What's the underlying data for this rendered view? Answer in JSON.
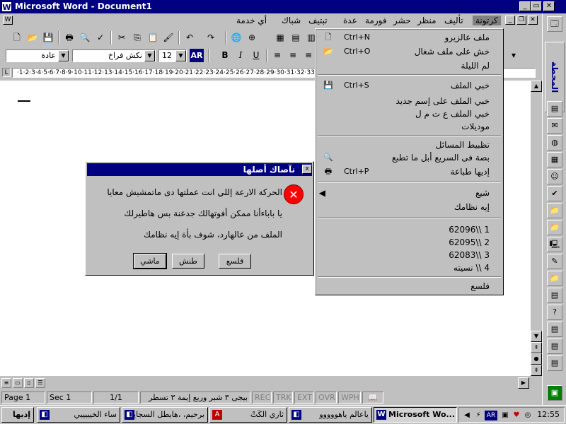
{
  "window": {
    "title": "Microsoft Word - Document1",
    "app_icon": "W"
  },
  "menubar": {
    "items": [
      "كرتونة",
      "تأليف",
      "منظر",
      "حشر",
      "فورمة",
      "عدة",
      "تبتيف",
      "شباك",
      "أي خدمة"
    ]
  },
  "toolbar": {
    "style_value": "عادة",
    "font_value": "نكش فراخ",
    "size_value": "12",
    "ar_label": "AR",
    "bold": "B",
    "italic": "I",
    "underline": "U"
  },
  "ruler": {
    "text": "·1·2·3·4·5·6·7·8·9·10·11·12·13·14·15·16·17·18·19·20·21·22·23·24·25·26·27·28·29·30·31·32·33·34·35·36·37·38·39·40·"
  },
  "file_menu": {
    "items": [
      {
        "label": "ملف عالزيرو",
        "shortcut": "Ctrl+N",
        "icon": "new-doc-icon"
      },
      {
        "label": "خش على ملف شغال",
        "shortcut": "Ctrl+O",
        "icon": "open-folder-icon"
      },
      {
        "label": "لم الليلة",
        "shortcut": "",
        "icon": ""
      },
      {
        "label": "خبي الملف",
        "shortcut": "Ctrl+S",
        "icon": "save-disk-icon"
      },
      {
        "label": "خبي الملف على إسم جديد",
        "shortcut": "",
        "icon": ""
      },
      {
        "label": "خبي الملف ع ت م ل",
        "shortcut": "",
        "icon": ""
      },
      {
        "label": "موديلات",
        "shortcut": "",
        "icon": ""
      },
      {
        "label": "تظبيط المسائل",
        "shortcut": "",
        "icon": ""
      },
      {
        "label": "بصة فى السريع أبل ما تطبع",
        "shortcut": "",
        "icon": "print-preview-icon"
      },
      {
        "label": "إديها طباعة",
        "shortcut": "Ctrl+P",
        "icon": "printer-icon"
      },
      {
        "label": "شيع",
        "shortcut": "",
        "icon": "",
        "submenu": true
      },
      {
        "label": "إيه نظامك",
        "shortcut": "",
        "icon": ""
      },
      {
        "label": "1 \\\\62096",
        "shortcut": "",
        "icon": ""
      },
      {
        "label": "2 \\\\62095",
        "shortcut": "",
        "icon": ""
      },
      {
        "label": "3 \\\\62083",
        "shortcut": "",
        "icon": ""
      },
      {
        "label": "4 \\\\ نسيته",
        "shortcut": "",
        "icon": ""
      },
      {
        "label": "فلسع",
        "shortcut": "",
        "icon": ""
      }
    ]
  },
  "dialog": {
    "title": "نآصاك أصلها",
    "close": "x",
    "lines": [
      "الحركة الارعة إللي انت عملتها دى ماتمشيش معايا",
      "يا باباءأنا ممكن أفوتهالك جدعنة بس هاطيرلك",
      "الملف من عالهارد، شوف بأة إيه نظامك"
    ],
    "buttons": [
      "فلسع",
      "طنش",
      "ماشي"
    ]
  },
  "statusbar": {
    "page": "Page 1",
    "sec": "Sec 1",
    "pages": "1/1",
    "position": "بيجى ٣ شبر وربع  إيمة ٣  تسطر",
    "rec": "REC",
    "trk": "TRK",
    "ext": "EXT",
    "ovr": "OVR",
    "wph": "WPH"
  },
  "taskbar": {
    "start": "إديها",
    "tasks": [
      "ساء الخيييييي",
      "برحيم، ،هايطل السجاير",
      "ثاري الكَتْ",
      "ياعالم ياهووووو",
      "Microsoft Wo..."
    ],
    "clock": "12:55",
    "lang": "AR"
  },
  "officebar": {
    "title": "المحطة"
  }
}
